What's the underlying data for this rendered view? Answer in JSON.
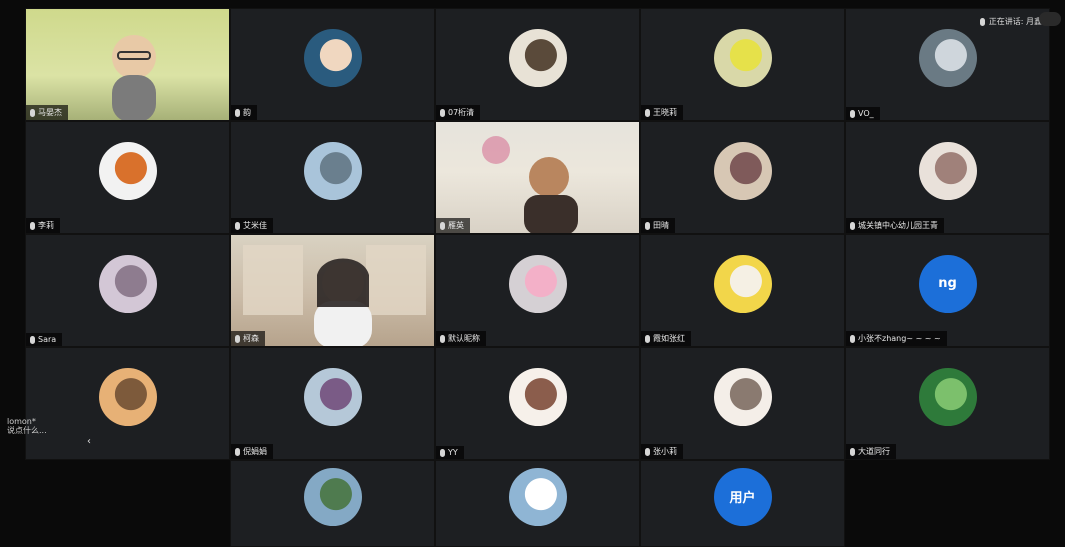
{
  "speaking_label": "正在讲话: 月鑫",
  "chat": {
    "sender": "lomon*",
    "preview": "说点什么..."
  },
  "tiles": [
    {
      "name": "马晏杰",
      "type": "video",
      "bg": "#cfd98c",
      "kind": "man"
    },
    {
      "name": "韵",
      "type": "avatar",
      "bg": "#2a5b7e",
      "accent": "#f0d7c0"
    },
    {
      "name": "07桁清",
      "type": "avatar",
      "bg": "#e8e2d6",
      "accent": "#5a4a3a"
    },
    {
      "name": "王晓莉",
      "type": "avatar",
      "bg": "#d9d8a8",
      "accent": "#e6e14a"
    },
    {
      "name": "VO_",
      "type": "avatar",
      "bg": "#6a7a84",
      "accent": "#cfd6dc"
    },
    {
      "name": "李莉",
      "type": "avatar",
      "bg": "#f2f2f2",
      "accent": "#d9712c"
    },
    {
      "name": "艾米佳",
      "type": "avatar",
      "bg": "#a9c4da",
      "accent": "#6a7f8e"
    },
    {
      "name": "雁英",
      "type": "video",
      "bg": "#e6e3dc",
      "kind": "woman"
    },
    {
      "name": "田晴",
      "type": "avatar",
      "bg": "#d7c7b4",
      "accent": "#7f5a5a"
    },
    {
      "name": "城关镇中心幼儿园王青",
      "type": "avatar",
      "bg": "#e9e1da",
      "accent": "#a0817a"
    },
    {
      "name": "Sara",
      "type": "avatar",
      "bg": "#d3c7d6",
      "accent": "#8e7c8f"
    },
    {
      "name": "柯森",
      "type": "video",
      "bg": "#d9d2c2",
      "kind": "woman2"
    },
    {
      "name": "默认昵称",
      "type": "avatar",
      "bg": "#d5d0d4",
      "accent": "#f3b0c8"
    },
    {
      "name": "霞如张红",
      "type": "avatar",
      "bg": "#f2d64a",
      "accent": "#f5f0e4"
    },
    {
      "name": "小张不zhang~ ~ ~ ~",
      "type": "text",
      "label": "ng"
    },
    {
      "name": "",
      "type": "avatar",
      "bg": "#e7b176",
      "accent": "#7d5a3b"
    },
    {
      "name": "倪娟娟",
      "type": "avatar",
      "bg": "#b5c8d8",
      "accent": "#7a5b86"
    },
    {
      "name": "YY",
      "type": "avatar",
      "bg": "#f6f0ea",
      "accent": "#8b5d4c"
    },
    {
      "name": "张小莉",
      "type": "avatar",
      "bg": "#f4eee8",
      "accent": "#8a7a70"
    },
    {
      "name": "大道同行",
      "type": "avatar",
      "bg": "#2e7a3a",
      "accent": "#7cc06c"
    },
    {
      "name": "",
      "type": "empty"
    },
    {
      "name": "",
      "type": "avatar",
      "bg": "#84a9c5",
      "accent": "#4f7b4f"
    },
    {
      "name": "",
      "type": "avatar",
      "bg": "#8fb5d4",
      "accent": "#ffffff"
    },
    {
      "name": "",
      "type": "text",
      "label": "用户"
    },
    {
      "name": "",
      "type": "empty"
    }
  ]
}
